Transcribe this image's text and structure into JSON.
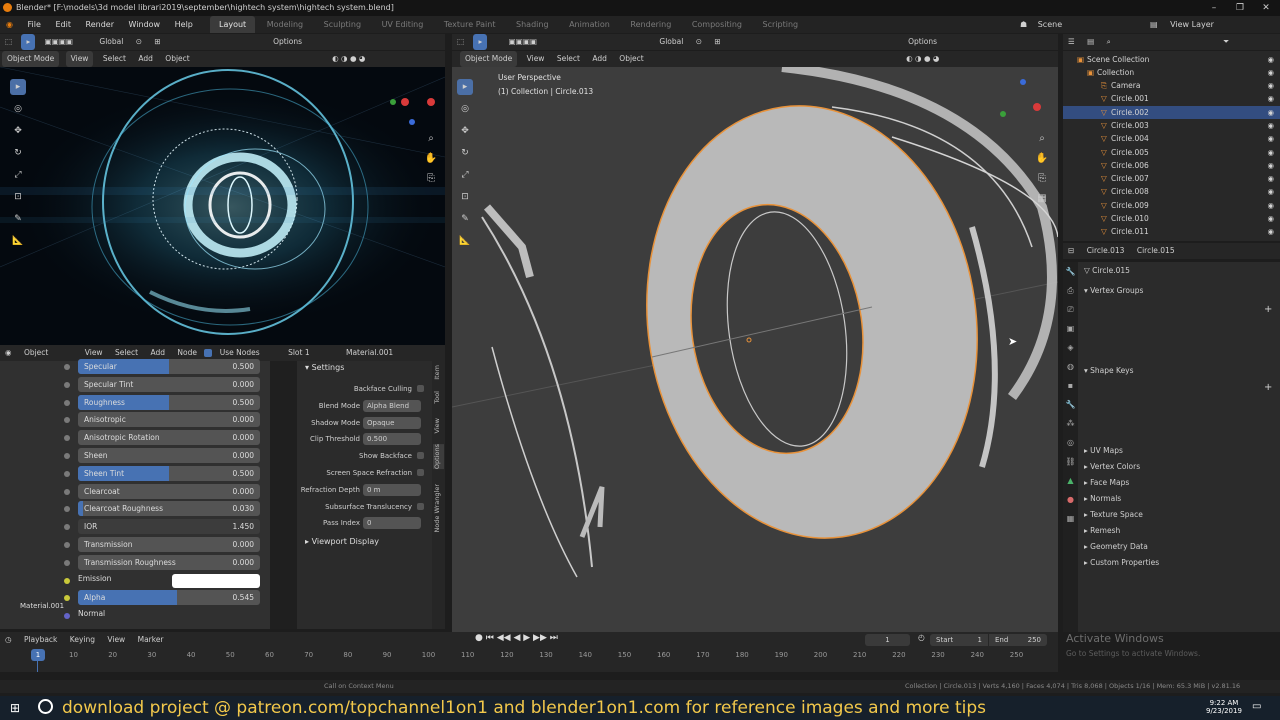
{
  "window": {
    "title": "Blender* [F:\\models\\3d model librari2019\\september\\hightech system\\hightech system.blend]"
  },
  "menu": [
    "File",
    "Edit",
    "Render",
    "Window",
    "Help"
  ],
  "workspaces": [
    "Layout",
    "Modeling",
    "Sculpting",
    "UV Editing",
    "Texture Paint",
    "Shading",
    "Animation",
    "Rendering",
    "Compositing",
    "Scripting"
  ],
  "scene_label": "Scene",
  "view_layer_label": "View Layer",
  "viewport_left": {
    "mode": "Object Mode",
    "menus": [
      "View",
      "Select",
      "Add",
      "Object"
    ],
    "orientation": "Global",
    "options": "Options"
  },
  "viewport_main": {
    "mode": "Object Mode",
    "menus": [
      "View",
      "Select",
      "Add",
      "Object"
    ],
    "orientation": "Global",
    "options": "Options",
    "perspective": "User Perspective",
    "collection_info": "(1) Collection | Circle.013"
  },
  "node_editor": {
    "header": {
      "object": "Object",
      "menus": [
        "View",
        "Select",
        "Add",
        "Node"
      ],
      "use_nodes": "Use Nodes",
      "slot": "Slot 1",
      "material": "Material.001"
    },
    "material_label": "Material.001",
    "rows": [
      {
        "label": "Specular",
        "value": "0.500",
        "fill": 0.5
      },
      {
        "label": "Specular Tint",
        "value": "0.000",
        "fill": 0
      },
      {
        "label": "Roughness",
        "value": "0.500",
        "fill": 0.5
      },
      {
        "label": "Anisotropic",
        "value": "0.000",
        "fill": 0
      },
      {
        "label": "Anisotropic Rotation",
        "value": "0.000",
        "fill": 0
      },
      {
        "label": "Sheen",
        "value": "0.000",
        "fill": 0
      },
      {
        "label": "Sheen Tint",
        "value": "0.500",
        "fill": 0.5
      },
      {
        "label": "Clearcoat",
        "value": "0.000",
        "fill": 0
      },
      {
        "label": "Clearcoat Roughness",
        "value": "0.030",
        "fill": 0.03
      },
      {
        "label": "IOR",
        "value": "1.450",
        "fill": 0
      },
      {
        "label": "Transmission",
        "value": "0.000",
        "fill": 0
      },
      {
        "label": "Transmission Roughness",
        "value": "0.000",
        "fill": 0
      },
      {
        "label": "Emission",
        "value": "",
        "fill": 0
      },
      {
        "label": "Alpha",
        "value": "0.545",
        "fill": 0.545
      },
      {
        "label": "Normal",
        "value": "",
        "fill": 0
      }
    ]
  },
  "settings": {
    "title": "Settings",
    "rows": [
      {
        "label": "",
        "value": "Backface Culling"
      },
      {
        "label": "Blend Mode",
        "value": "Alpha Blend"
      },
      {
        "label": "Shadow Mode",
        "value": "Opaque"
      },
      {
        "label": "Clip Threshold",
        "value": "0.500"
      },
      {
        "label": "",
        "value": "Show Backface"
      },
      {
        "label": "",
        "value": "Screen Space Refraction"
      },
      {
        "label": "Refraction Depth",
        "value": "0 m"
      },
      {
        "label": "",
        "value": "Subsurface Translucency"
      },
      {
        "label": "Pass Index",
        "value": "0"
      }
    ],
    "viewport_display": "Viewport Display",
    "tabs": [
      "Item",
      "Tool",
      "View",
      "Options",
      "Node Wrangler"
    ]
  },
  "outliner": {
    "root": "Scene Collection",
    "collection": "Collection",
    "items": [
      "Camera",
      "Circle.001",
      "Circle.002",
      "Circle.003",
      "Circle.004",
      "Circle.005",
      "Circle.006",
      "Circle.007",
      "Circle.008",
      "Circle.009",
      "Circle.010",
      "Circle.011"
    ],
    "selected": "Circle.002"
  },
  "properties": {
    "breadcrumb_object": "Circle.013",
    "breadcrumb_mesh": "Circle.015",
    "mesh_name": "Circle.015",
    "vertex_groups": "Vertex Groups",
    "shape_keys": "Shape Keys",
    "panels": [
      "UV Maps",
      "Vertex Colors",
      "Face Maps",
      "Normals",
      "Texture Space",
      "Remesh",
      "Geometry Data",
      "Custom Properties"
    ]
  },
  "timeline": {
    "menus": [
      "Playback",
      "Keying",
      "View",
      "Marker"
    ],
    "current_frame": "1",
    "start_label": "Start",
    "start": "1",
    "end_label": "End",
    "end": "250",
    "ticks": [
      "10",
      "20",
      "30",
      "40",
      "50",
      "60",
      "70",
      "80",
      "90",
      "100",
      "110",
      "120",
      "130",
      "140",
      "150",
      "160",
      "170",
      "180",
      "190",
      "200",
      "210",
      "220",
      "230",
      "240",
      "250"
    ],
    "frame_marker": "1"
  },
  "status": {
    "center": "Call on Context Menu",
    "right": "Collection | Circle.013 | Verts 4,160 | Faces 4,074 | Tris 8,068 | Objects 1/16 | Mem: 65.3 MiB | v2.81.16"
  },
  "watermark": {
    "line1": "Activate Windows",
    "line2": "Go to Settings to activate Windows."
  },
  "banner": "download project @ patreon.com/topchannel1on1  and blender1on1.com for reference images and more tips",
  "taskbar": {
    "time": "9:22 AM",
    "date": "9/23/2019"
  },
  "colors": {
    "accent": "#4772b3",
    "selection_outline": "#e8923a",
    "banner_text": "#f2c84b",
    "hologram": "#7fe6ff"
  }
}
